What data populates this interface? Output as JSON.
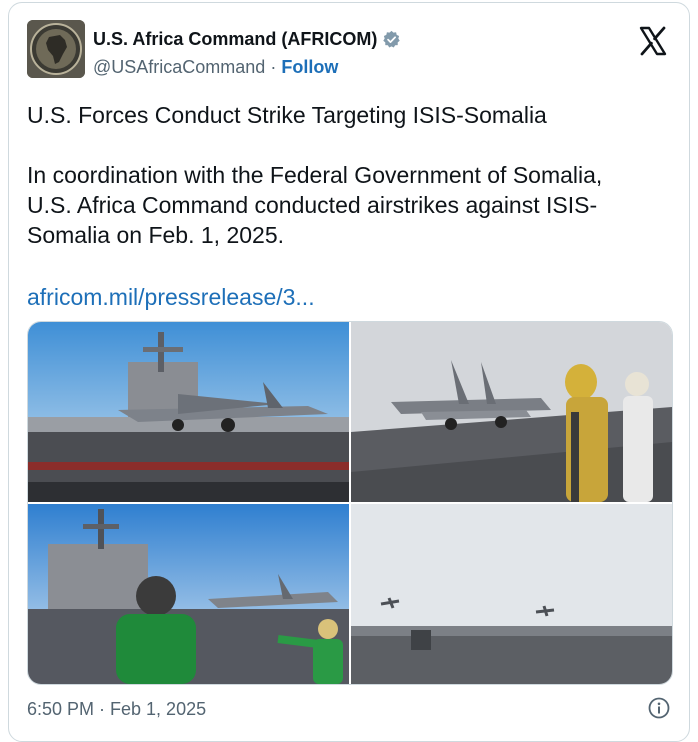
{
  "tweet": {
    "author_name": "U.S. Africa Command (AFRICOM)",
    "handle": "@USAfricaCommand",
    "separator": " · ",
    "follow_label": "Follow",
    "headline": "U.S. Forces Conduct Strike Targeting ISIS-Somalia",
    "body_line1": "In coordination with the Federal Government of Somalia,",
    "body_line2": "U.S. Africa Command conducted airstrikes against ISIS-",
    "body_line3": "Somalia on Feb. 1, 2025.",
    "link_text": "africom.mil/pressrelease/3...",
    "timestamp": "6:50 PM · Feb 1, 2025"
  },
  "media": [
    {
      "alt": "F/A-18 jet on carrier deck in front of ship island"
    },
    {
      "alt": "Jet launching while crew in yellow and white vests watch"
    },
    {
      "alt": "Crew member in green jersey and helmet near jet and ship island"
    },
    {
      "alt": "Two jets flying over carrier deck"
    }
  ],
  "icons": {
    "verified": "verified-badge-icon",
    "platform": "x-logo-icon",
    "info": "info-icon",
    "avatar": "africom-seal"
  },
  "colors": {
    "link": "#1d6fb8",
    "text": "#0f1419",
    "secondary": "#536471",
    "border": "#cfd9de"
  }
}
